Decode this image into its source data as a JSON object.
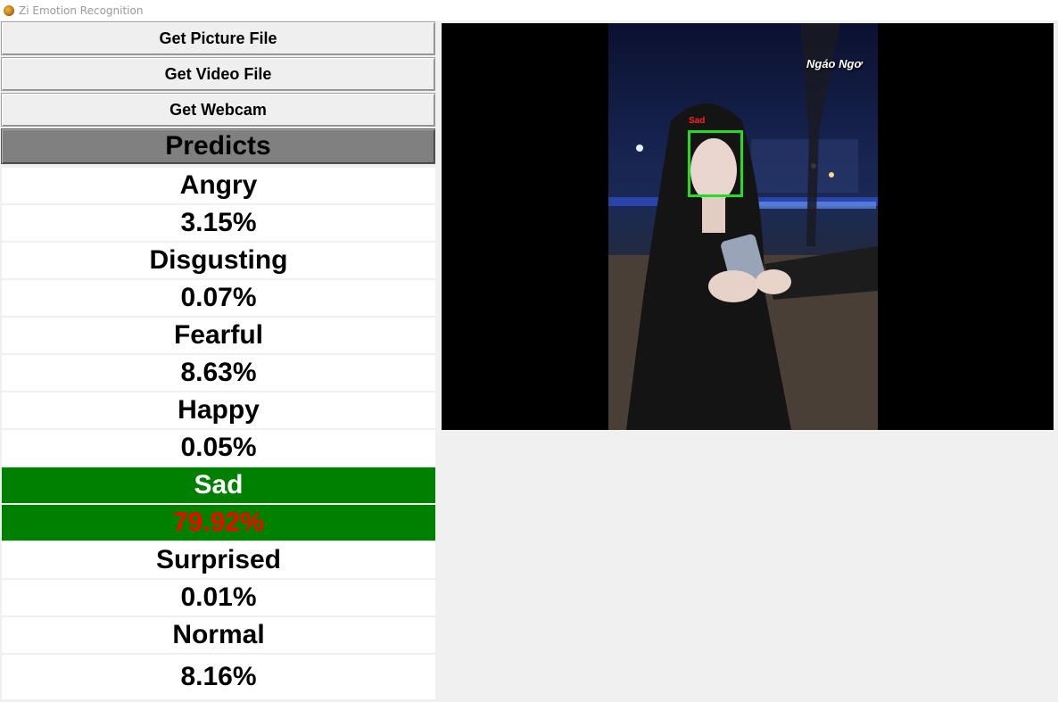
{
  "window": {
    "title": "Zi Emotion Recognition"
  },
  "buttons": {
    "picture": "Get Picture File",
    "video": "Get Video File",
    "webcam": "Get Webcam"
  },
  "predicts_header": "Predicts",
  "predictions": [
    {
      "label": "Angry",
      "value": "3.15%"
    },
    {
      "label": "Disgusting",
      "value": "0.07%"
    },
    {
      "label": "Fearful",
      "value": "8.63%"
    },
    {
      "label": "Happy",
      "value": "0.05%"
    },
    {
      "label": "Sad",
      "value": "79.92%",
      "highlighted": true
    },
    {
      "label": "Surprised",
      "value": "0.01%"
    },
    {
      "label": "Normal",
      "value": "8.16%"
    }
  ],
  "preview": {
    "watermark": "Ngáo Ngơ",
    "face_label": "Sad",
    "face_box_color": "#22dd22",
    "face_label_color": "#ff2222"
  },
  "colors": {
    "highlight_bg": "#008000",
    "highlight_label": "#ffffff",
    "highlight_value": "#ff0000"
  }
}
